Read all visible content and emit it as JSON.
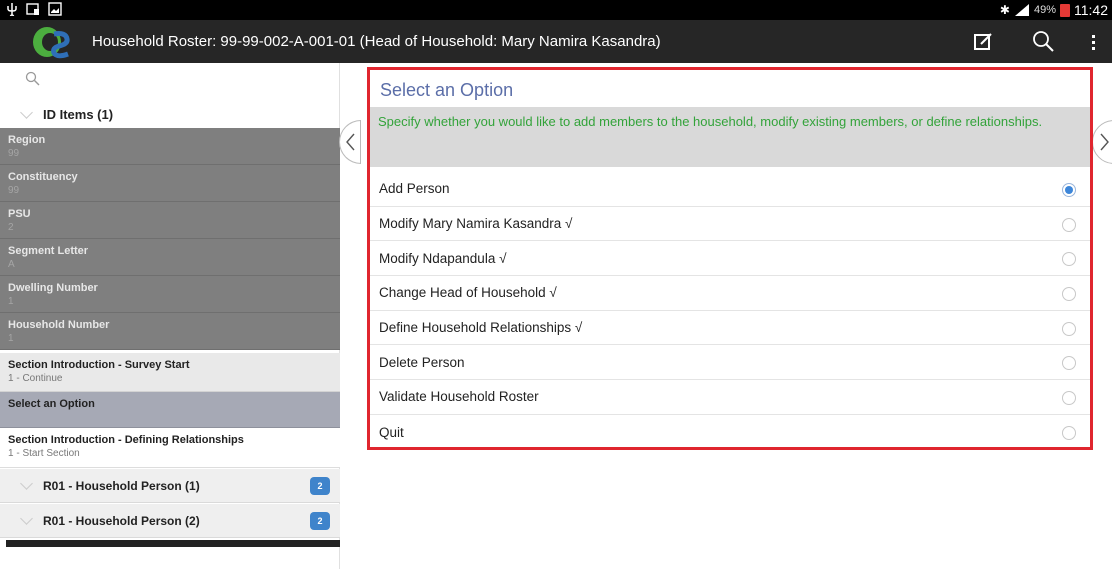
{
  "status_bar": {
    "left_icons": [
      "usb-icon",
      "debug-icon",
      "image-icon"
    ],
    "bluetooth_glyph": "✱",
    "battery_percent": "49%",
    "time": "11:42"
  },
  "action_bar": {
    "title": "Household Roster: 99-99-002-A-001-01 (Head of Household: Mary Namira Kasandra)",
    "actions": [
      "edit-icon",
      "search-icon",
      "overflow-menu-icon"
    ]
  },
  "sidebar": {
    "group": {
      "label": "ID Items (1)"
    },
    "id_items": [
      {
        "label": "Region",
        "value": "99"
      },
      {
        "label": "Constituency",
        "value": "99"
      },
      {
        "label": "PSU",
        "value": "2"
      },
      {
        "label": "Segment Letter",
        "value": "A"
      },
      {
        "label": "Dwelling Number",
        "value": "1"
      },
      {
        "label": "Household Number",
        "value": "1"
      }
    ],
    "sections": [
      {
        "label": "Section Introduction - Survey Start",
        "value": "1 - Continue"
      },
      {
        "label": "Select an Option"
      },
      {
        "label": "Section Introduction - Defining Relationships",
        "value": "1 - Start Section"
      }
    ],
    "rosters": [
      {
        "label": "R01 - Household Person (1)",
        "badge": "2"
      },
      {
        "label": "R01 - Household Person (2)",
        "badge": "2"
      }
    ]
  },
  "question": {
    "title": "Select an Option",
    "help": "Specify whether you would like to add members to the household, modify existing members, or define relationships.",
    "selected_index": 0,
    "options": [
      "Add Person",
      "Modify Mary Namira Kasandra √",
      "Modify Ndapandula √",
      "Change Head of Household √",
      "Define Household Relationships √",
      "Delete Person",
      "Validate Household Roster",
      "Quit"
    ]
  },
  "colors": {
    "highlight_border": "#e0262f",
    "question_title": "#5b6ea8",
    "help_text": "#33a33a",
    "radio_selected": "#3d86d9",
    "badge": "#3f84cb"
  }
}
